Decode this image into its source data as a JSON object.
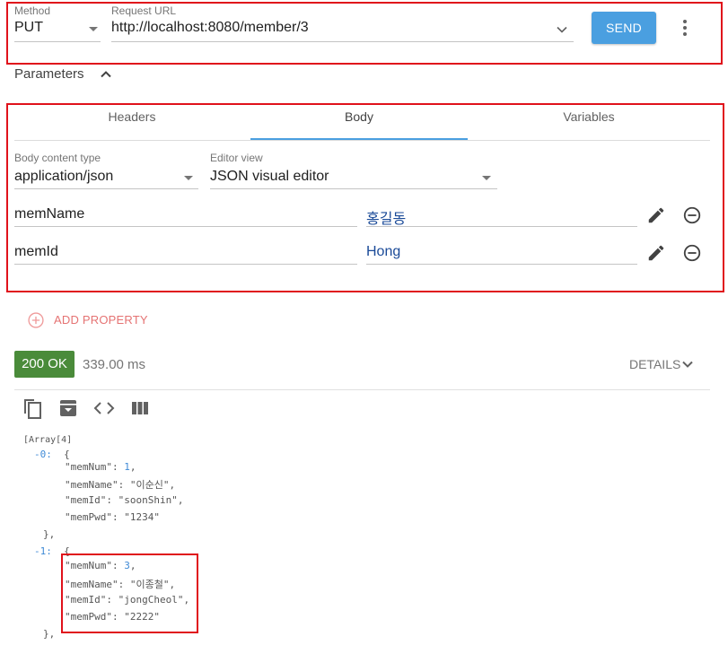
{
  "request": {
    "method_label": "Method",
    "method_value": "PUT",
    "url_label": "Request URL",
    "url_value": "http://localhost:8080/member/3",
    "send_label": "SEND"
  },
  "parameters": {
    "label": "Parameters"
  },
  "tabs": [
    {
      "label": "Headers",
      "active": false
    },
    {
      "label": "Body",
      "active": true
    },
    {
      "label": "Variables",
      "active": false
    }
  ],
  "body_settings": {
    "content_type_label": "Body content type",
    "content_type_value": "application/json",
    "editor_view_label": "Editor view",
    "editor_view_value": "JSON visual editor"
  },
  "properties": [
    {
      "name": "memName",
      "value": "홍길동"
    },
    {
      "name": "memId",
      "value": "Hong"
    }
  ],
  "add_property_label": "ADD PROPERTY",
  "response": {
    "status": "200 OK",
    "time": "339.00 ms",
    "details_label": "DETAILS"
  },
  "json_view": {
    "array_label": "[Array[4]",
    "items": [
      {
        "index": "-0:",
        "fields": [
          {
            "key": "\"memNum\"",
            "value": "1",
            "type": "num"
          },
          {
            "key": "\"memName\"",
            "value": "\"이순신\"",
            "type": "str"
          },
          {
            "key": "\"memId\"",
            "value": "\"soonShin\"",
            "type": "str"
          },
          {
            "key": "\"memPwd\"",
            "value": "\"1234\"",
            "type": "str"
          }
        ]
      },
      {
        "index": "-1:",
        "fields": [
          {
            "key": "\"memNum\"",
            "value": "3",
            "type": "num"
          },
          {
            "key": "\"memName\"",
            "value": "\"이종철\"",
            "type": "str"
          },
          {
            "key": "\"memId\"",
            "value": "\"jongCheol\"",
            "type": "str"
          },
          {
            "key": "\"memPwd\"",
            "value": "\"2222\"",
            "type": "str"
          }
        ]
      }
    ]
  },
  "colors": {
    "accent": "#4a9fe0",
    "highlight_box": "#e0121b",
    "status_ok": "#4a8b3a",
    "add_property": "#e57373"
  }
}
